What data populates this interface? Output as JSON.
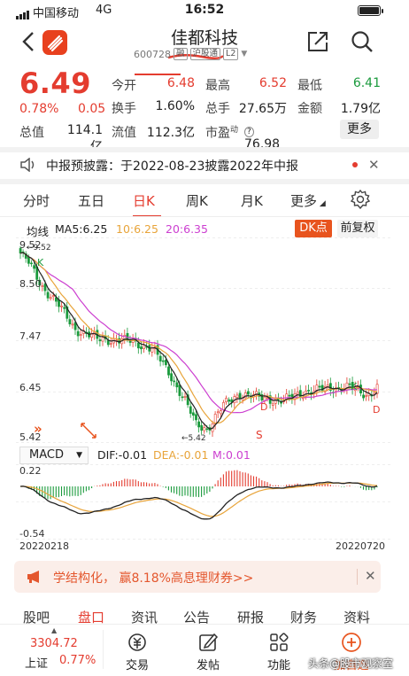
{
  "status": {
    "carrier": "中国移动",
    "network": "4G",
    "time": "16:52"
  },
  "header": {
    "title": "佳都科技",
    "code": "600728",
    "tags": [
      "融",
      "沪股通",
      "L2"
    ]
  },
  "quote": {
    "price": "6.49",
    "change_pct": "0.78%",
    "change": "0.05",
    "rows": [
      {
        "l1": "今开",
        "v1": "6.48",
        "l2": "最高",
        "v2": "6.52",
        "l3": "最低",
        "v3": "6.41"
      },
      {
        "l1": "换手",
        "v1": "1.60%",
        "l2": "总手",
        "v2": "27.65万",
        "l3": "金额",
        "v3": "1.79亿"
      },
      {
        "l1": "总值",
        "v1": "114.1亿",
        "l2": "流值",
        "v2": "112.3亿",
        "l3": "市盈",
        "l3sup": "动",
        "v3": "76.98"
      }
    ],
    "more_label": "更多"
  },
  "notice": {
    "text": "中报预披露：于2022-08-23披露2022年中报"
  },
  "period_tabs": [
    "分时",
    "五日",
    "日K",
    "周K",
    "月K",
    "更多"
  ],
  "active_period": "日K",
  "ma": {
    "label": "均线",
    "ma5": "MA5:6.25",
    "ma10": "10:6.25",
    "ma20": "20:6.35"
  },
  "buttons": {
    "dk": "DK点",
    "fq": "前复权"
  },
  "kline": {
    "y_labels": [
      "9.52",
      "8.50",
      "7.47",
      "6.45",
      "5.42"
    ],
    "high_label": "9.52",
    "low_label": "5.42",
    "markers": [
      "K",
      "K",
      "D",
      "D",
      "S"
    ]
  },
  "macd": {
    "selector": "MACD",
    "dif": "DIF:-0.01",
    "dea": "DEA:-0.01",
    "m": "M:0.01",
    "y_top": "0.22",
    "y_bottom": "-0.54",
    "date_start": "20220218",
    "date_end": "20220720"
  },
  "banner": {
    "text": "学结构化， 赢8.18%高息理财券>>"
  },
  "bottom_tabs": [
    "股吧",
    "盘口",
    "资讯",
    "公告",
    "研报",
    "财务",
    "资料"
  ],
  "active_bottom_tab": "盘口",
  "bottom_bar": {
    "index_value": "3304.72",
    "index_name": "上证",
    "index_pct": "0.77%",
    "items": [
      "交易",
      "发帖",
      "功能",
      "加自选"
    ]
  },
  "watermark": "头条@股市观察室",
  "colors": {
    "up": "#e43c2f",
    "down": "#1a9a3c",
    "accent": "#e8541e",
    "ma5": "#222222",
    "ma10": "#e8a43a",
    "ma20": "#cc3fd0"
  }
}
